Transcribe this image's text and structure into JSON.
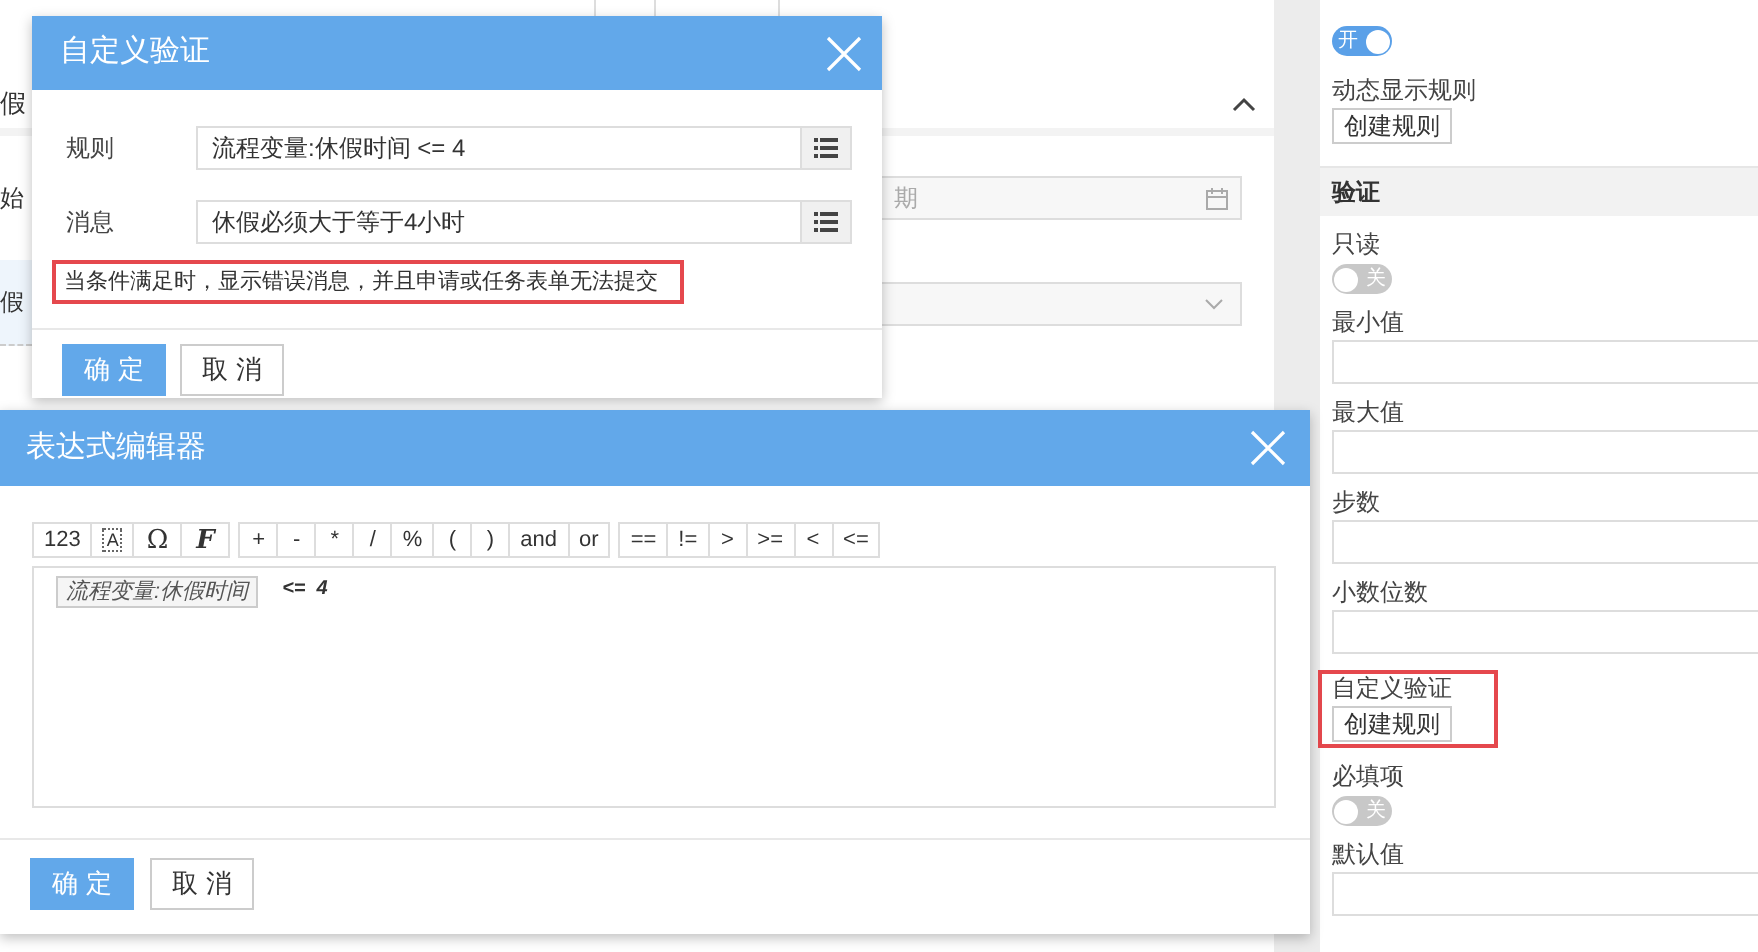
{
  "background_form": {
    "section_title": "假",
    "date_label": "始",
    "date_placeholder": "期",
    "duration_label": "假"
  },
  "properties_panel": {
    "items": [
      {
        "kind": "toggle",
        "on": true,
        "text": "开"
      },
      {
        "kind": "button",
        "label": "动态显示规则",
        "button": "创建规则",
        "highlighted": false
      },
      {
        "kind": "section",
        "label": "验证"
      },
      {
        "kind": "toggle",
        "label": "只读",
        "on": false,
        "text": "关"
      },
      {
        "kind": "input",
        "label": "最小值"
      },
      {
        "kind": "input",
        "label": "最大值"
      },
      {
        "kind": "input",
        "label": "步数"
      },
      {
        "kind": "input",
        "label": "小数位数"
      },
      {
        "kind": "button",
        "label": "自定义验证",
        "button": "创建规则",
        "highlighted": true
      },
      {
        "kind": "toggle",
        "label": "必填项",
        "on": false,
        "text": "关"
      },
      {
        "kind": "input",
        "label": "默认值"
      }
    ]
  },
  "custom_validation_dialog": {
    "title": "自定义验证",
    "fields": [
      {
        "label": "规则",
        "value": "流程变量:休假时间 <= 4"
      },
      {
        "label": "消息",
        "value": "休假必须大于等于4小时"
      }
    ],
    "note": "当条件满足时，显示错误消息，并且申请或任务表单无法提交",
    "note_highlighted": true,
    "buttons": [
      {
        "label": "确 定",
        "primary": true
      },
      {
        "label": "取 消",
        "primary": false
      }
    ]
  },
  "expression_editor": {
    "title": "表达式编辑器",
    "toolbar_groups": [
      [
        {
          "label": "123",
          "kind": "small"
        },
        {
          "label": "A",
          "kind": "boxed"
        },
        {
          "label": "Ω",
          "kind": "symbol"
        },
        {
          "label": "F",
          "kind": "script"
        }
      ],
      [
        {
          "label": "+",
          "kind": "text"
        },
        {
          "label": "-",
          "kind": "text"
        },
        {
          "label": "*",
          "kind": "text"
        },
        {
          "label": "/",
          "kind": "text"
        },
        {
          "label": "%",
          "kind": "text"
        },
        {
          "label": "(",
          "kind": "text"
        },
        {
          "label": ")",
          "kind": "text"
        },
        {
          "label": "and",
          "kind": "text"
        },
        {
          "label": "or",
          "kind": "text"
        }
      ],
      [
        {
          "label": "==",
          "kind": "text"
        },
        {
          "label": "!=",
          "kind": "text"
        },
        {
          "label": ">",
          "kind": "text"
        },
        {
          "label": ">=",
          "kind": "text"
        },
        {
          "label": "<",
          "kind": "text"
        },
        {
          "label": "<=",
          "kind": "text"
        }
      ]
    ],
    "expression": {
      "variable": "流程变量:休假时间",
      "rest": "<=  4"
    },
    "buttons": [
      {
        "label": "确 定",
        "primary": true
      },
      {
        "label": "取 消",
        "primary": false
      }
    ]
  }
}
